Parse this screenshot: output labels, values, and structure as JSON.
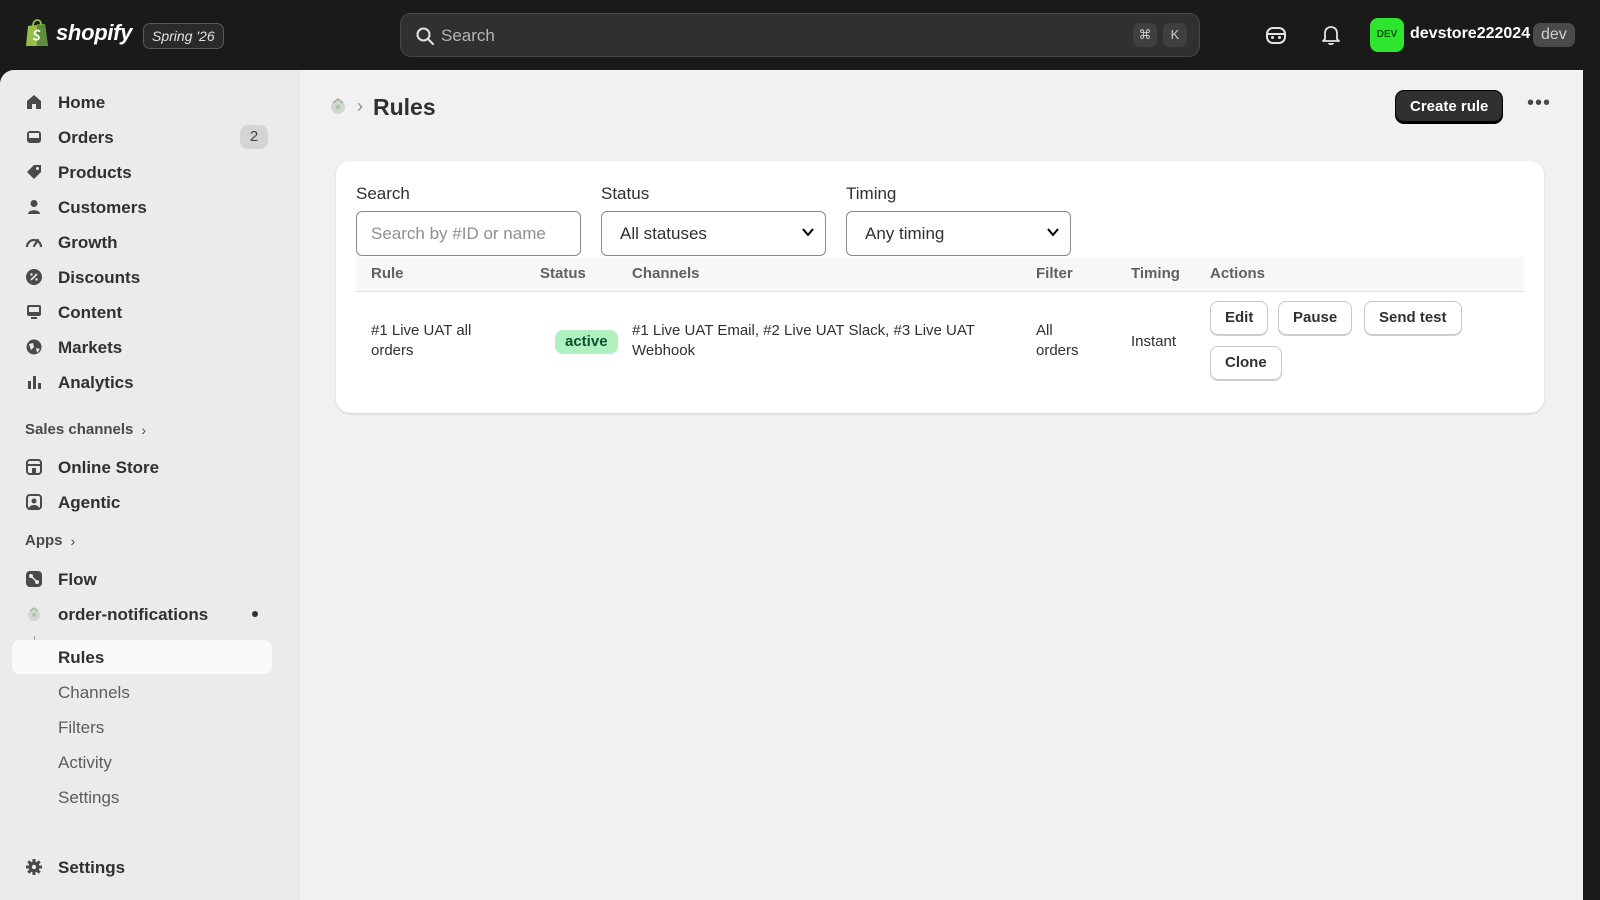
{
  "topbar": {
    "brand": "shopify",
    "version": "Spring '26",
    "search_placeholder": "Search",
    "kbd_cmd": "⌘",
    "kbd_k": "K",
    "avatar_text": "DEV",
    "store_name": "devstore222024",
    "env_badge": "dev"
  },
  "sidebar": {
    "main_items": [
      {
        "label": "Home",
        "icon": "home-icon"
      },
      {
        "label": "Orders",
        "icon": "inbox-icon",
        "badge": "2"
      },
      {
        "label": "Products",
        "icon": "tag-icon"
      },
      {
        "label": "Customers",
        "icon": "person-icon"
      },
      {
        "label": "Growth",
        "icon": "gauge-icon"
      },
      {
        "label": "Discounts",
        "icon": "discount-icon"
      },
      {
        "label": "Content",
        "icon": "content-icon"
      },
      {
        "label": "Markets",
        "icon": "globe-icon"
      },
      {
        "label": "Analytics",
        "icon": "bar-chart-icon"
      }
    ],
    "sales_channels_label": "Sales channels",
    "sales_channels": [
      {
        "label": "Online Store",
        "icon": "store-icon"
      },
      {
        "label": "Agentic",
        "icon": "agentic-icon"
      }
    ],
    "apps_label": "Apps",
    "apps": [
      {
        "label": "Flow",
        "icon": "flow-icon"
      },
      {
        "label": "order-notifications",
        "icon": "app-icon"
      }
    ],
    "app_subitems": [
      "Rules",
      "Channels",
      "Filters",
      "Activity",
      "Settings"
    ],
    "settings_label": "Settings"
  },
  "page": {
    "title": "Rules",
    "create_label": "Create rule",
    "more_label": "•••"
  },
  "filters": {
    "search_label": "Search",
    "search_placeholder": "Search by #ID or name",
    "status_label": "Status",
    "status_value": "All statuses",
    "timing_label": "Timing",
    "timing_value": "Any timing"
  },
  "table": {
    "headers": [
      "Rule",
      "Status",
      "Channels",
      "Filter",
      "Timing",
      "Actions"
    ],
    "rows": [
      {
        "rule_line1": "#1 Live UAT all",
        "rule_line2": "orders",
        "status": "active",
        "channels_line1": "#1 Live UAT Email, #2 Live UAT Slack, #3 Live UAT",
        "channels_line2": "Webhook",
        "filter_line1": "All",
        "filter_line2": "orders",
        "timing": "Instant",
        "actions": [
          "Edit",
          "Pause",
          "Send test",
          "Clone"
        ]
      }
    ]
  },
  "colors": {
    "topbar_bg": "#1a1a1a",
    "sidebar_bg": "#ebebeb",
    "main_bg": "#f1f1f1",
    "active_badge_bg": "#aff0bf",
    "active_badge_text": "#0c5132",
    "avatar_bg": "#2ee62e"
  }
}
